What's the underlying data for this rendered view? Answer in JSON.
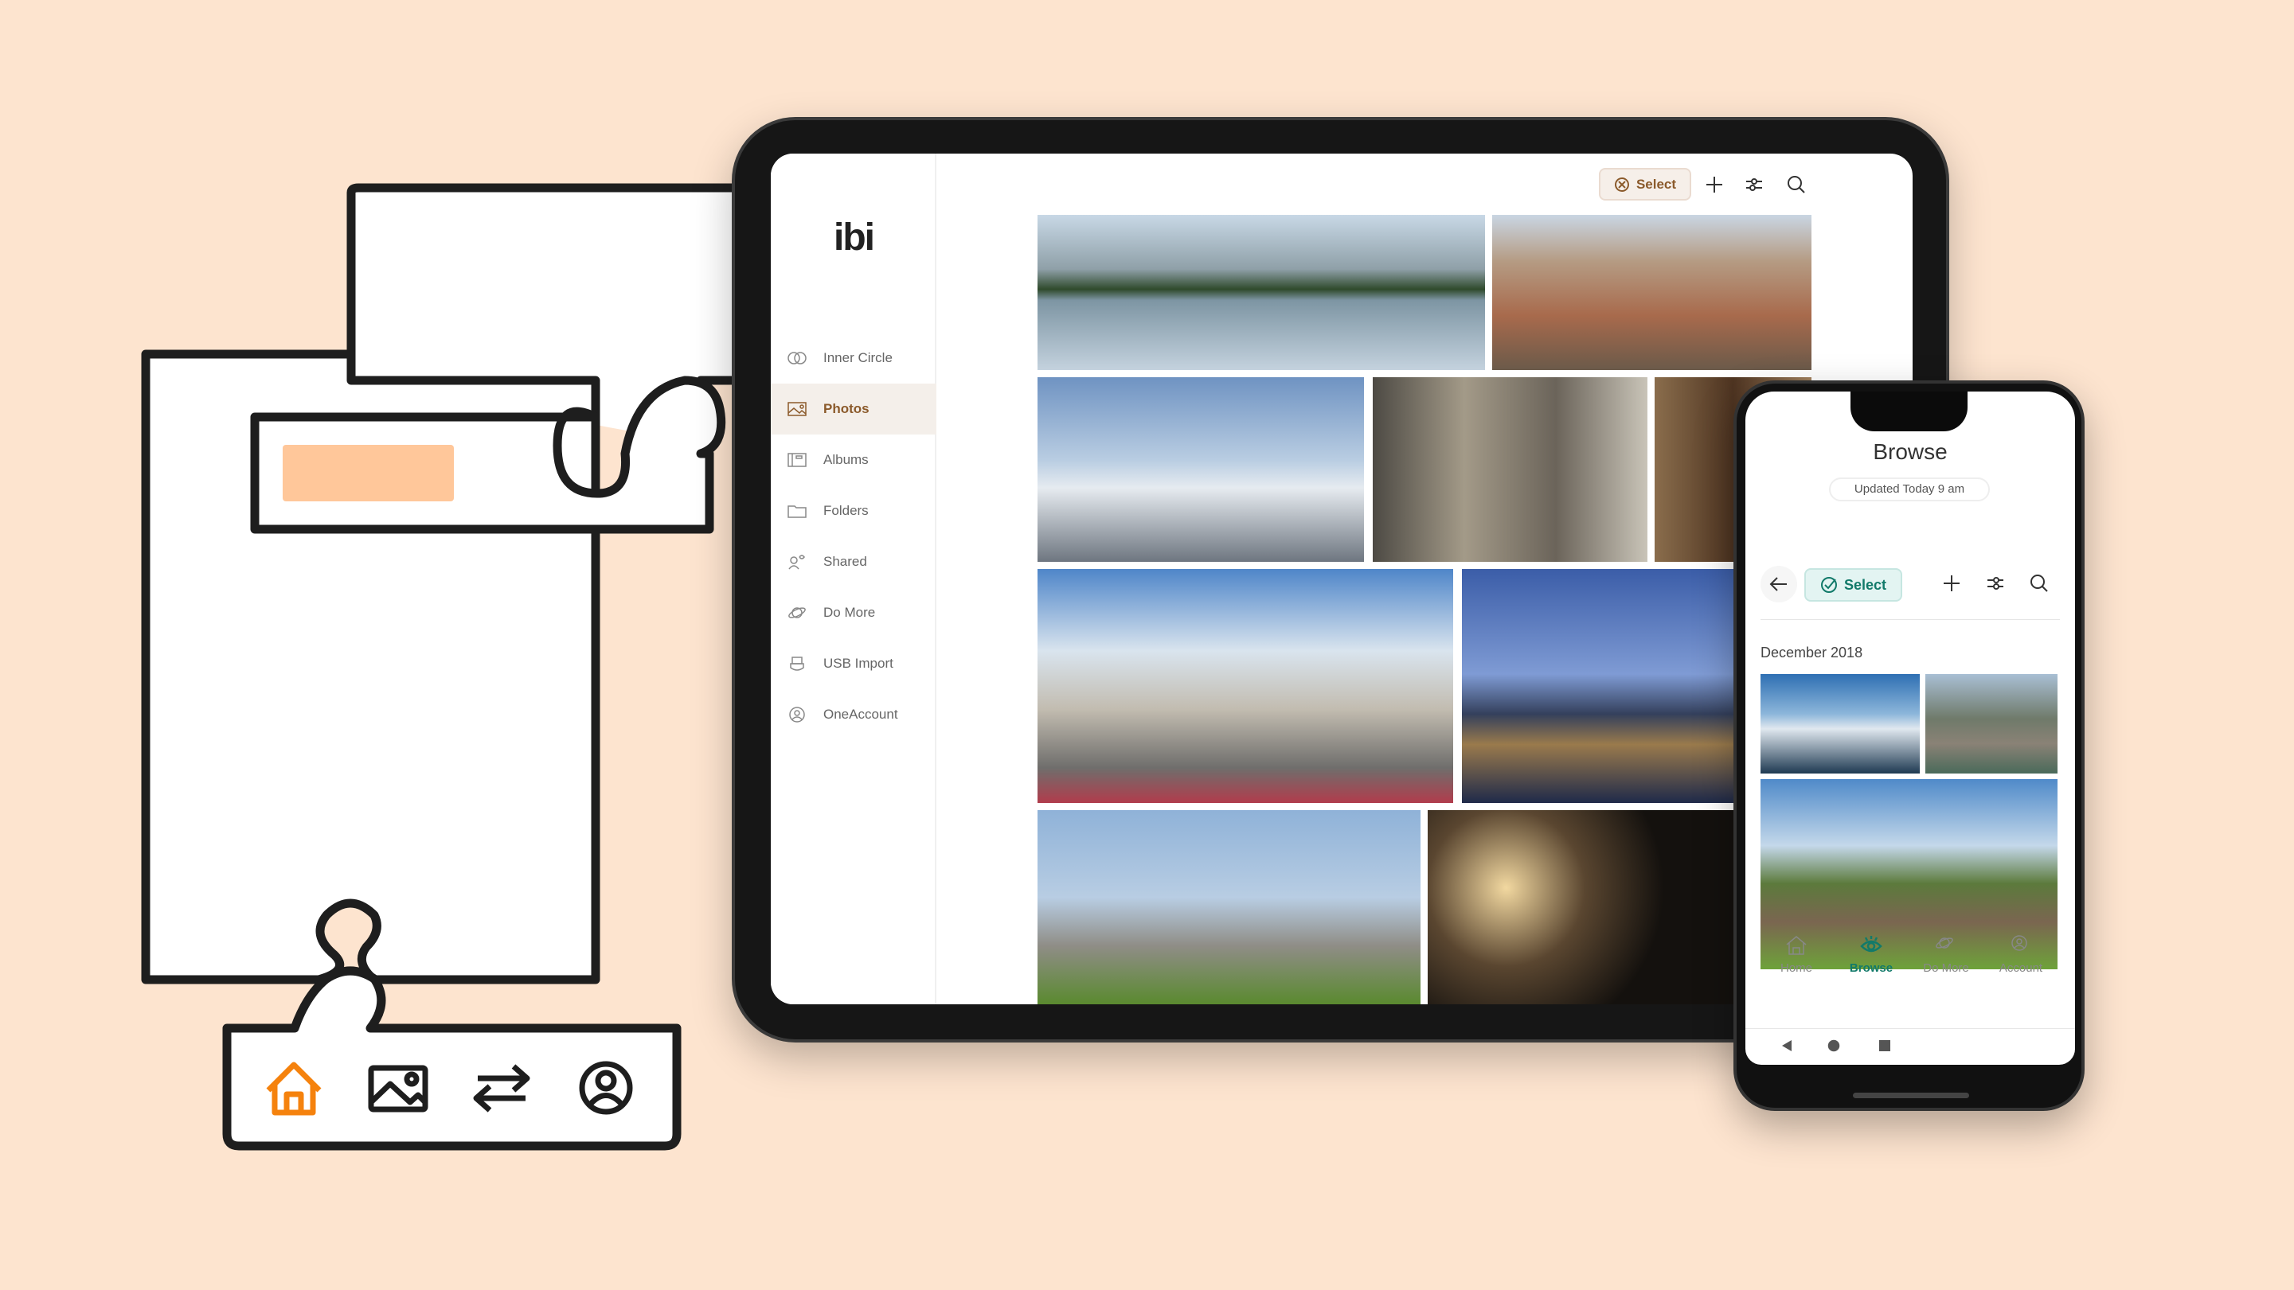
{
  "colors": {
    "background": "#fde4cf",
    "accent_brown": "#8b5a2b",
    "accent_teal": "#127a6a",
    "orange": "#f5820d",
    "orange_fill": "#ffc79a"
  },
  "illustration": {
    "icons": [
      "home-icon",
      "image-icon",
      "swap-icon",
      "account-icon"
    ]
  },
  "tablet": {
    "logo": "ibi",
    "sidebar": [
      {
        "label": "Inner Circle",
        "icon": "inner-circle-icon"
      },
      {
        "label": "Photos",
        "icon": "photo-icon",
        "active": true
      },
      {
        "label": "Albums",
        "icon": "album-icon"
      },
      {
        "label": "Folders",
        "icon": "folder-icon"
      },
      {
        "label": "Shared",
        "icon": "shared-icon"
      },
      {
        "label": "Do More",
        "icon": "planet-icon"
      },
      {
        "label": "USB Import",
        "icon": "usb-icon"
      },
      {
        "label": "OneAccount",
        "icon": "account-icon"
      }
    ],
    "toolbar": {
      "select_label": "Select"
    }
  },
  "phone": {
    "title": "Browse",
    "updated": "Updated Today 9 am",
    "select_label": "Select",
    "section": "December 2018",
    "nav": [
      {
        "label": "Home",
        "icon": "home-icon"
      },
      {
        "label": "Browse",
        "icon": "eye-icon",
        "active": true
      },
      {
        "label": "Do More",
        "icon": "planet-icon"
      },
      {
        "label": "Account",
        "icon": "account-icon"
      }
    ]
  }
}
